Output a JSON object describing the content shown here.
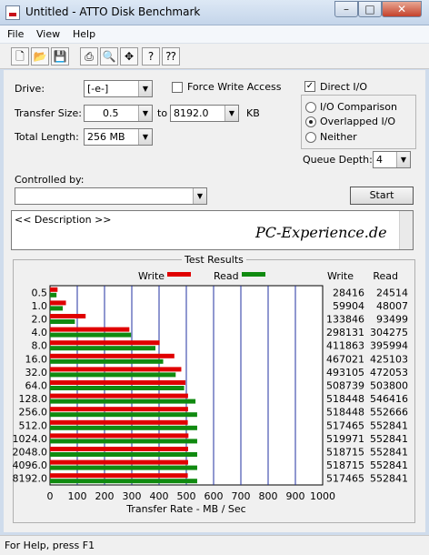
{
  "window": {
    "title": "Untitled - ATTO Disk Benchmark",
    "min": "–",
    "max": "□",
    "close": "✕"
  },
  "menu": [
    "File",
    "View",
    "Help"
  ],
  "toolbar": [
    "new-icon",
    "open-icon",
    "save-icon",
    "print-icon",
    "print-preview-icon",
    "move-icon",
    "help-icon",
    "context-help-icon"
  ],
  "settings": {
    "drive_label": "Drive:",
    "drive_value": "[-e-]",
    "transfer_label": "Transfer Size:",
    "transfer_from": "0.5",
    "transfer_to_label": "to",
    "transfer_to": "8192.0",
    "transfer_unit": "KB",
    "length_label": "Total Length:",
    "length_value": "256 MB",
    "force_write_label": "Force Write Access",
    "force_write_checked": false,
    "direct_io_label": "Direct I/O",
    "direct_io_checked": true,
    "io_options": [
      "I/O Comparison",
      "Overlapped I/O",
      "Neither"
    ],
    "io_selected": "Overlapped I/O",
    "queue_label": "Queue Depth:",
    "queue_value": "4",
    "controlled_label": "Controlled by:",
    "controlled_value": "",
    "start_label": "Start",
    "description": "<< Description >>",
    "watermark": "PC-Experience.de"
  },
  "results_title": "Test Results",
  "chart_data": {
    "type": "bar",
    "orientation": "horizontal",
    "legend": [
      "Write",
      "Read"
    ],
    "colors": {
      "write": "#e00000",
      "read": "#108a10"
    },
    "col_headers": [
      "Write",
      "Read"
    ],
    "categories": [
      "0.5",
      "1.0",
      "2.0",
      "4.0",
      "8.0",
      "16.0",
      "32.0",
      "64.0",
      "128.0",
      "256.0",
      "512.0",
      "1024.0",
      "2048.0",
      "4096.0",
      "8192.0"
    ],
    "series": [
      {
        "name": "Write",
        "values": [
          28416,
          59904,
          133846,
          298131,
          411863,
          467021,
          493105,
          508739,
          518448,
          518448,
          517465,
          519971,
          518715,
          518715,
          517465
        ]
      },
      {
        "name": "Read",
        "values": [
          24514,
          48007,
          93499,
          304275,
          395994,
          425103,
          472053,
          503800,
          546416,
          552666,
          552841,
          552841,
          552841,
          552841,
          552841
        ]
      }
    ],
    "xlabel": "Transfer Rate - MB / Sec",
    "xticks": [
      "0",
      "100",
      "200",
      "300",
      "400",
      "500",
      "600",
      "700",
      "800",
      "900",
      "1000"
    ],
    "xlim": [
      0,
      1000
    ]
  },
  "status": "For Help, press F1"
}
